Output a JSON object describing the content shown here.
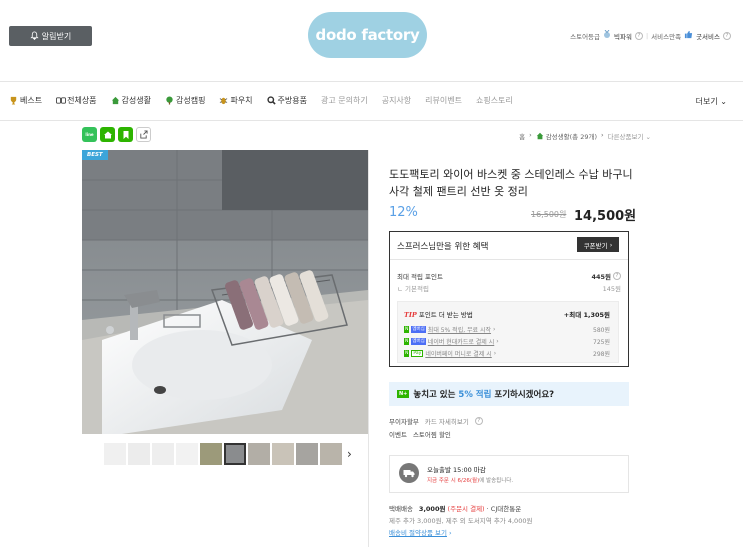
{
  "header": {
    "alarm_label": "알림받기",
    "logo_text": "dodo factory",
    "store_grade_label": "스토어등급",
    "store_grade_value": "빅파워",
    "service_label": "서비스만족",
    "service_value": "굿서비스"
  },
  "nav": {
    "items": [
      {
        "label": "베스트",
        "icon": "trophy-icon",
        "color": "#c8941c"
      },
      {
        "label": "전체상품",
        "icon": "grid-icon",
        "color": "#444444"
      },
      {
        "label": "감성생활",
        "icon": "house-icon",
        "color": "#3a9a3a"
      },
      {
        "label": "감성캠핑",
        "icon": "tree-icon",
        "color": "#3a9a3a"
      },
      {
        "label": "파우치",
        "icon": "bug-icon",
        "color": "#c8941c"
      },
      {
        "label": "주방용품",
        "icon": "search-icon",
        "color": "#333333"
      },
      {
        "label": "광고 문의하기",
        "light": true
      },
      {
        "label": "공지사항",
        "light": true
      },
      {
        "label": "리뷰이벤트",
        "light": true
      },
      {
        "label": "쇼핑스토리",
        "light": true
      }
    ],
    "more_label": "더보기"
  },
  "share": {
    "line_label": "line",
    "home_label": "home",
    "bookmark_label": "bookmark",
    "share_label": "share"
  },
  "breadcrumb": {
    "home": "홈",
    "category": "감성생활(총 29개)",
    "other": "다른상품보기"
  },
  "product": {
    "best_tag": "BEST",
    "title": "도도팩토리 와이어 바스켓 중 스테인레스 수납 바구니 사각 철제 팬트리 선반 옷 정리",
    "discount": "12%",
    "original_price": "16,500원",
    "price": "14,500원"
  },
  "benefit": {
    "heading": "스프러스님만을 위한 혜택",
    "coupon_label": "쿠폰받기",
    "max_points_label": "최대 적립 포인트",
    "max_points_value": "445원",
    "basic_label": "ㄴ 기본적립",
    "basic_value": "145원",
    "tip_label": "TIP",
    "tip_text": "포인트 더 받는 방법",
    "tip_max": "+최대 1,305원",
    "sub_rows": [
      {
        "badges": [
          "N",
          "멤버십"
        ],
        "text": "최대 5% 적립, 무료 시작",
        "value": "580원"
      },
      {
        "badges": [
          "N",
          "멤버십"
        ],
        "text": "네이버 현대카드로 결제 시",
        "value": "725원"
      },
      {
        "badges": [
          "N",
          "Pay"
        ],
        "text": "네이버페이 머니로 결제 시",
        "value": "298원"
      }
    ]
  },
  "promo": {
    "badge": "N+",
    "text_before": "놓치고 있는 ",
    "highlight": "5% 적립",
    "text_after": " 포기하시겠어요?"
  },
  "payment": {
    "row1_label": "무이자할부",
    "row1_link": "카드 자세히보기",
    "row2_label": "이벤트",
    "row2_value": "스토어찜 할인"
  },
  "shipping": {
    "title": "오늘출발 15:00 마감",
    "sub_red": "지금 주문 시 6/26(월)",
    "sub_grey": "에 발송됩니다."
  },
  "delivery": {
    "label": "택배배송",
    "fee": "3,000원",
    "fee_note": "(주문시 결제)",
    "carrier": "· CJ대한통운",
    "extra": "제주 추가 3,000원, 제주 외 도서지역 추가 4,000원",
    "link": "배송비 절약상품 보기"
  },
  "colors": {
    "accent_blue": "#5aa0e6",
    "promo_bg": "#e8f3fc",
    "naver_green": "#2db400",
    "tip_red": "#e53b3b",
    "logo_bg": "#9fd1e3"
  }
}
